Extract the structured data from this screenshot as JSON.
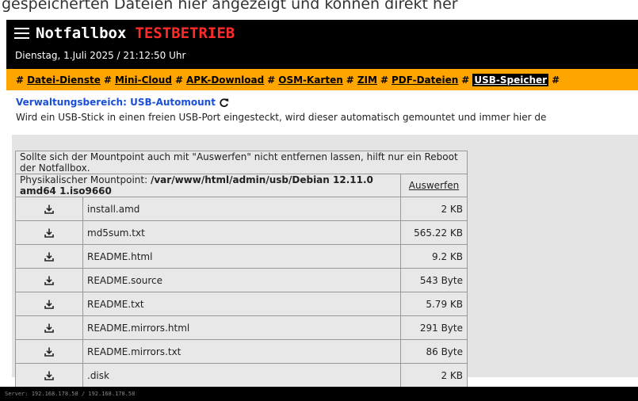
{
  "top_text": "gespeicherten Dateien hier angezeigt und können direkt her",
  "header": {
    "brand_name": "Notfallbox",
    "brand_mode": "TESTBETRIEB",
    "datetime": "Dienstag, 1.Juli 2025 / 21:12:50 Uhr"
  },
  "nav": {
    "hash": "#",
    "items": [
      {
        "label": "Datei-Dienste"
      },
      {
        "label": "Mini-Cloud"
      },
      {
        "label": "APK-Download"
      },
      {
        "label": "OSM-Karten"
      },
      {
        "label": "ZIM"
      },
      {
        "label": "PDF-Dateien"
      },
      {
        "label": "USB-Speicher",
        "active": true
      }
    ]
  },
  "section": {
    "title": "Verwaltungsbereich: USB-Automount",
    "intro": "Wird ein USB-Stick in einen freien USB-Port eingesteckt, wird dieser automatisch gemountet und immer hier de"
  },
  "table": {
    "notice": "Sollte sich der Mountpoint auch mit \"Auswerfen\" nicht entfernen lassen, hilft nur ein Reboot der Notfallbox.",
    "mount_label": "Physikalischer Mountpoint:",
    "mount_path": "/var/www/html/admin/usb/Debian 12.11.0 amd64 1.iso9660",
    "eject_label": "Auswerfen",
    "rows": [
      {
        "name": "install.amd",
        "size": "2 KB"
      },
      {
        "name": "md5sum.txt",
        "size": "565.22 KB"
      },
      {
        "name": "README.html",
        "size": "9.2 KB"
      },
      {
        "name": "README.source",
        "size": "543 Byte"
      },
      {
        "name": "README.txt",
        "size": "5.79 KB"
      },
      {
        "name": "README.mirrors.html",
        "size": "291 Byte"
      },
      {
        "name": "README.mirrors.txt",
        "size": "86 Byte"
      },
      {
        "name": ".disk",
        "size": "2 KB"
      }
    ]
  },
  "footer": {
    "server": "Server: 192.168.178.58 / 192.168.178.58"
  },
  "colors": {
    "accent_orange": "#ffa500",
    "mode_red": "#ff2a2a",
    "title_blue": "#1a4fd8"
  },
  "icons": {
    "menu": "hamburger-icon",
    "refresh": "refresh-icon",
    "download": "download-icon"
  }
}
